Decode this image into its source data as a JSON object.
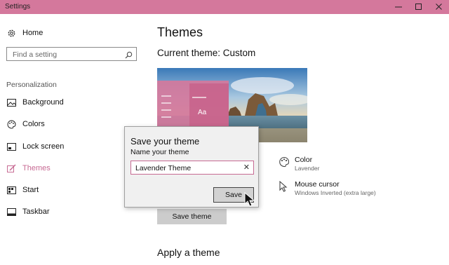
{
  "window": {
    "title": "Settings",
    "controls": [
      "minimize-icon",
      "maximize-icon",
      "close-icon"
    ]
  },
  "sidebar": {
    "home_label": "Home",
    "search_placeholder": "Find a setting",
    "section_label": "Personalization",
    "items": [
      {
        "label": "Background",
        "icon": "picture-icon"
      },
      {
        "label": "Colors",
        "icon": "palette-icon"
      },
      {
        "label": "Lock screen",
        "icon": "lock-screen-icon"
      },
      {
        "label": "Themes",
        "icon": "brush-icon",
        "active": true
      },
      {
        "label": "Start",
        "icon": "start-icon"
      },
      {
        "label": "Taskbar",
        "icon": "taskbar-icon"
      }
    ]
  },
  "main": {
    "title": "Themes",
    "current_theme": "Current theme: Custom",
    "preview_sample_text": "Aa",
    "options": [
      {
        "label": "Color",
        "value": "Lavender",
        "icon": "palette-icon"
      },
      {
        "label": "Mouse cursor",
        "value": "Windows Inverted (extra large)",
        "icon": "cursor-icon"
      }
    ],
    "save_theme_button": "Save theme",
    "apply_heading": "Apply a theme"
  },
  "dialog": {
    "title": "Save your theme",
    "name_label": "Name your theme",
    "name_value": "Lavender Theme",
    "save_button": "Save"
  },
  "colors": {
    "accent": "#d4789c",
    "active_nav": "#c76a93"
  }
}
